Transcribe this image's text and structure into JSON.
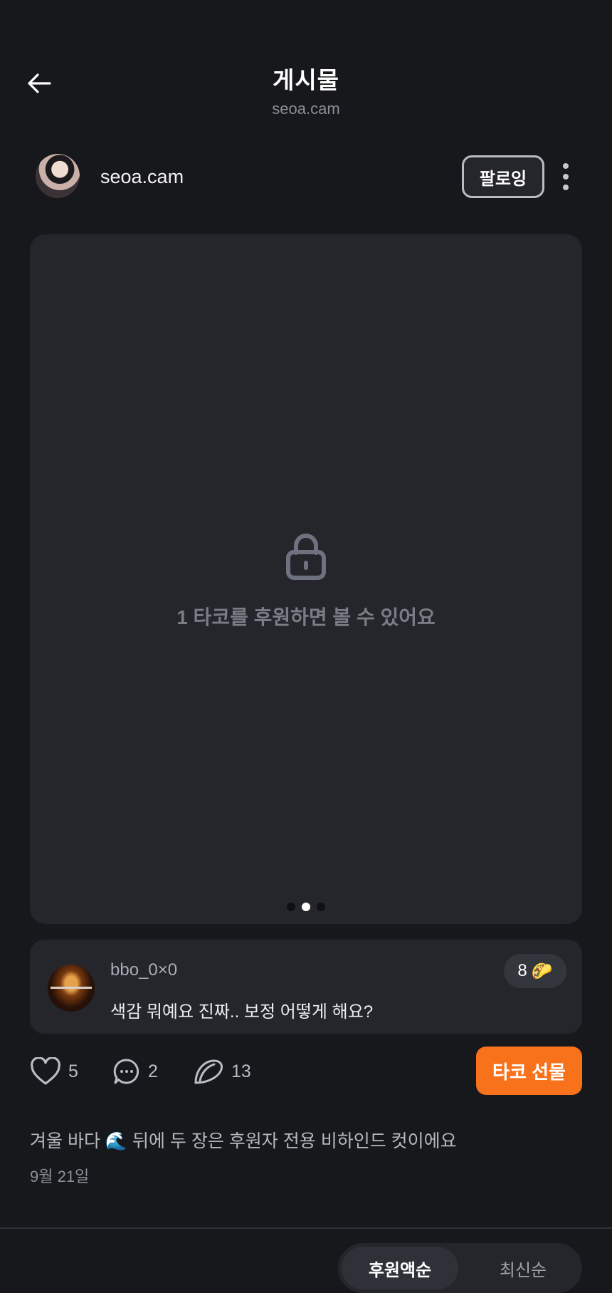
{
  "header": {
    "title": "게시물",
    "subtitle": "seoa.cam"
  },
  "author": {
    "name": "seoa.cam",
    "follow_label": "팔로잉"
  },
  "media": {
    "locked_text": "1 타코를 후원하면 볼 수 있어요",
    "slides_count": 3,
    "active_slide": 2
  },
  "top_comment": {
    "user": "bbo_0×0",
    "text": "색감 뭐예요 진짜.. 보정 어떻게 해요?",
    "tip_count": "8",
    "tip_emoji": "🌮"
  },
  "actions": {
    "likes": "5",
    "comments": "2",
    "tacos": "13",
    "gift_label": "타코 선물"
  },
  "post": {
    "caption": "겨울 바다 🌊  뒤에 두 장은 후원자 전용 비하인드 컷이에요",
    "date": "9월 21일"
  },
  "sort": {
    "options": [
      "후원액순",
      "최신순"
    ],
    "selected": "후원액순"
  },
  "colors": {
    "background": "#17181c",
    "card": "#24262c",
    "accent": "#f8711b"
  }
}
